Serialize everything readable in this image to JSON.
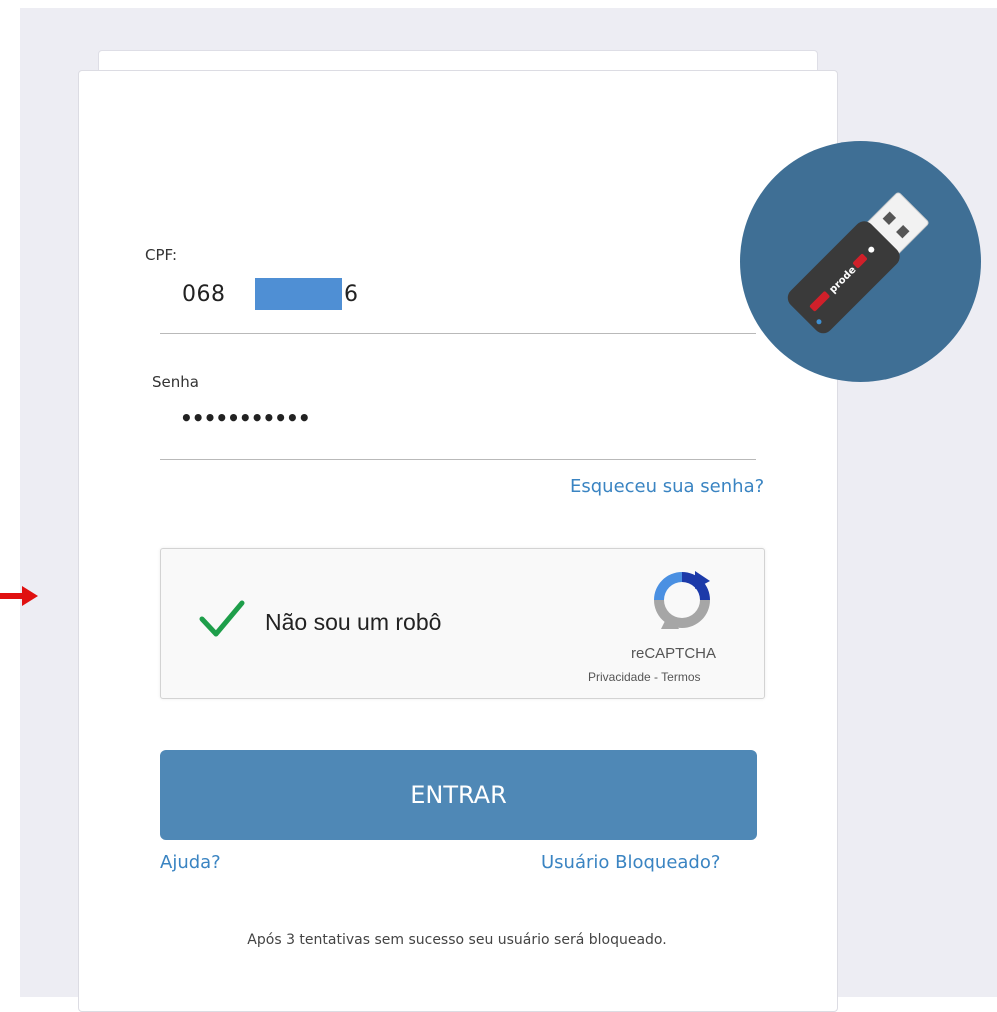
{
  "form": {
    "cpf_label": "CPF:",
    "cpf_value_start": "068",
    "cpf_value_end": "6",
    "password_label": "Senha",
    "password_value": "•••••••••••",
    "forgot_password": "Esqueceu sua senha?"
  },
  "captcha": {
    "label": "Não sou um robô",
    "brand": "reCAPTCHA",
    "terms": "Privacidade - Termos",
    "checked": true
  },
  "actions": {
    "submit_label": "ENTRAR",
    "help_link": "Ajuda?",
    "blocked_link": "Usuário Bloqueado?"
  },
  "footer": {
    "note": "Após 3 tentativas sem sucesso seu usuário será bloqueado."
  },
  "icons": {
    "usb": "usb-token-icon",
    "check": "checkmark-icon",
    "recaptcha": "recaptcha-logo-icon",
    "arrow": "arrow-right-icon"
  },
  "colors": {
    "accent": "#4f88b6",
    "link": "#3a84c2",
    "usb_circle": "#3f6f95",
    "check": "#1e9e4a",
    "arrow": "#e01010"
  }
}
